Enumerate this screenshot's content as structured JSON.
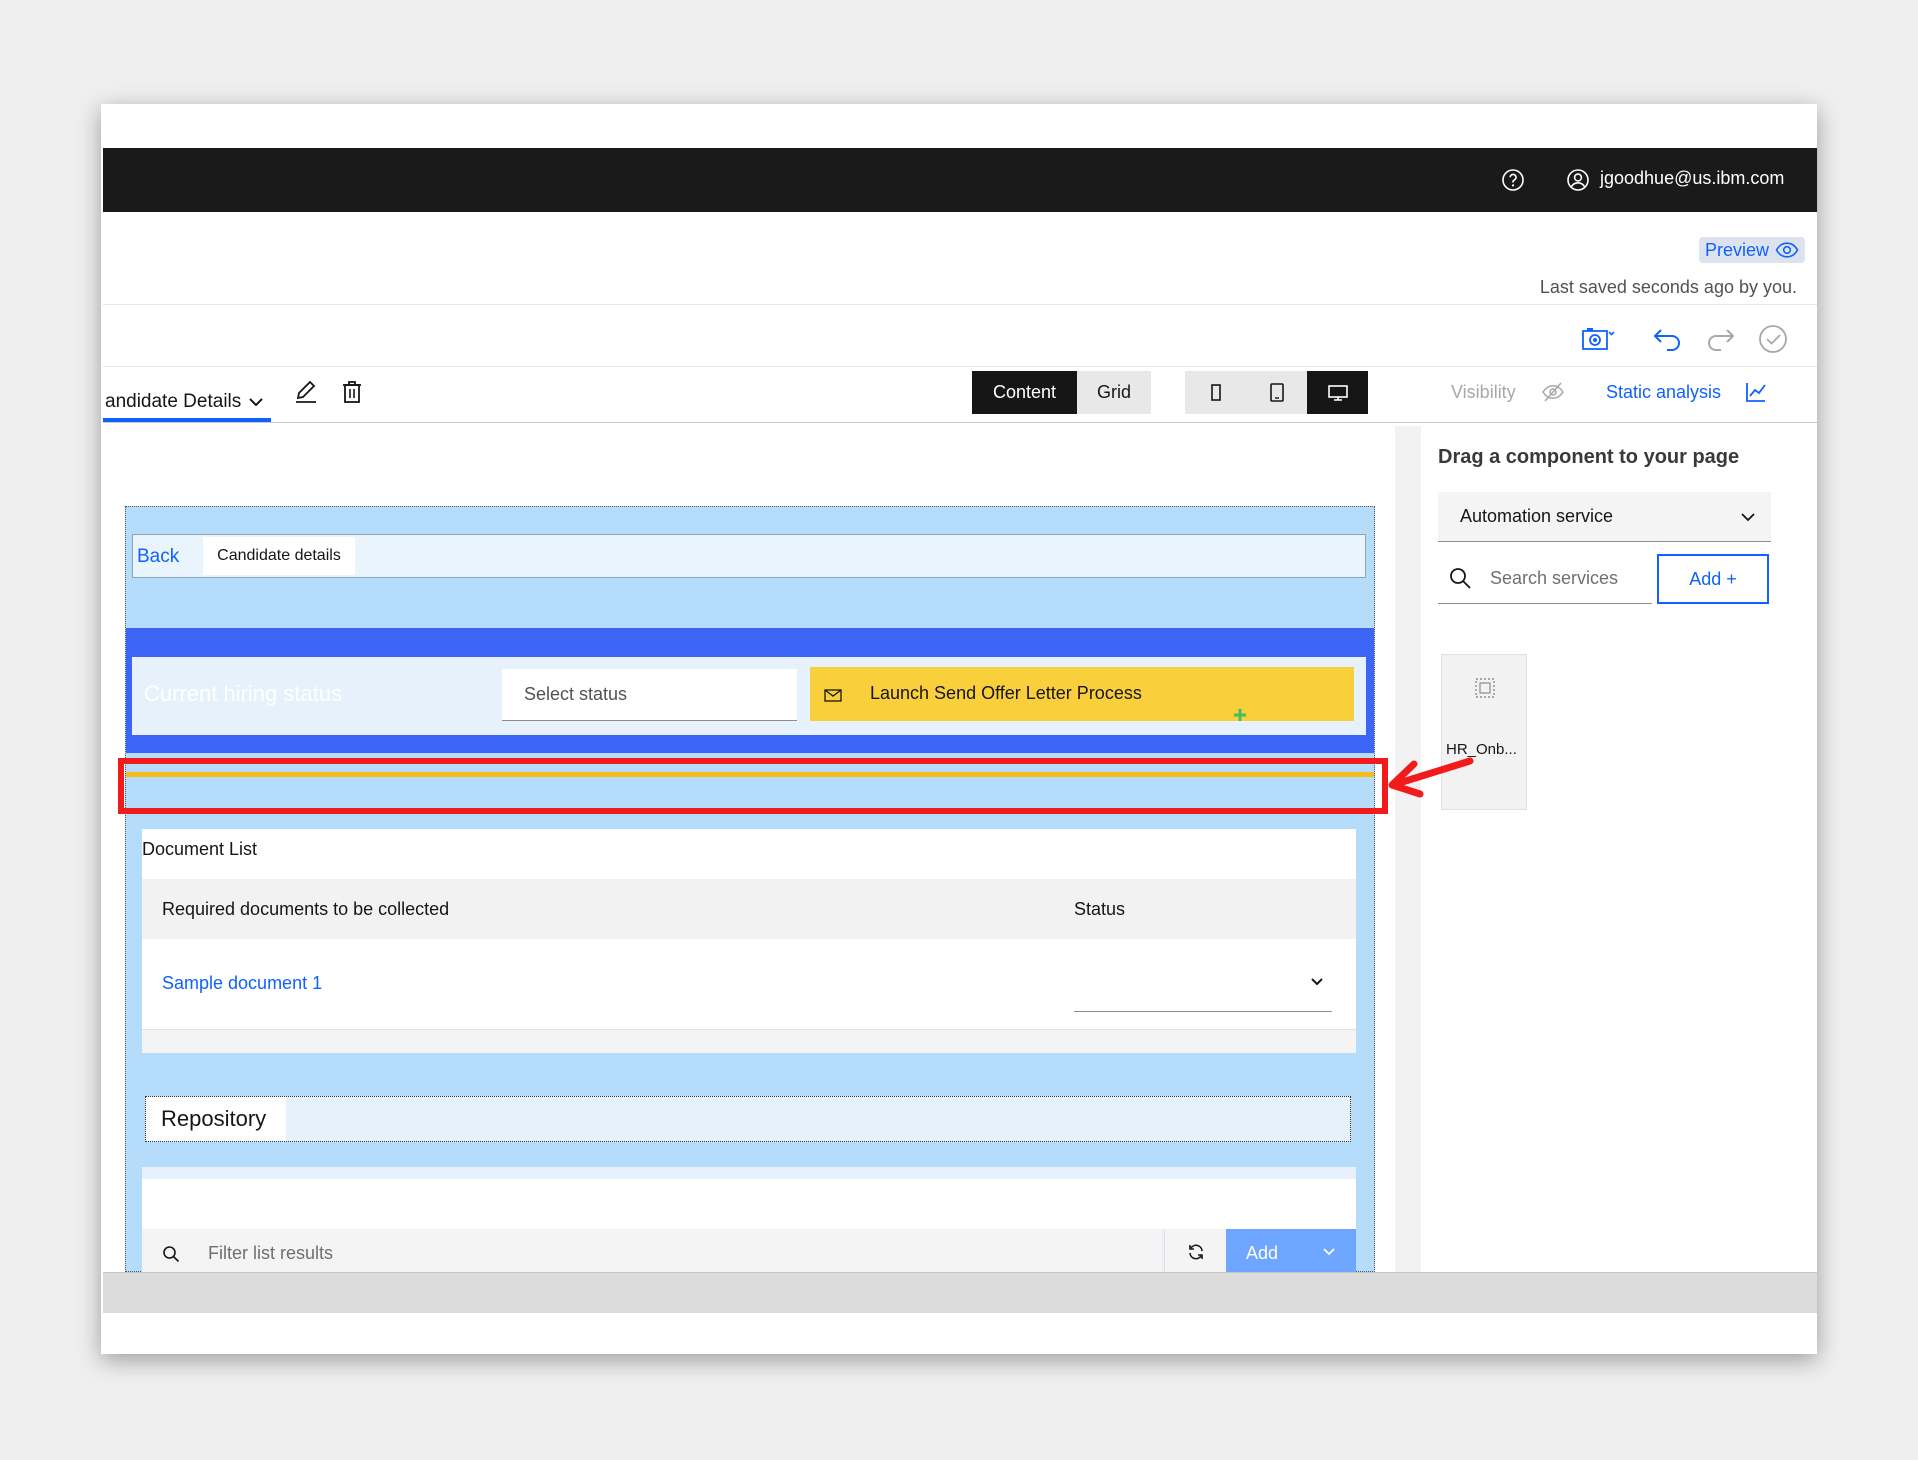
{
  "topbar": {
    "user_email": "jgoodhue@us.ibm.com",
    "help_icon": "help-icon",
    "user_icon": "user-avatar-icon"
  },
  "header": {
    "preview_label": "Preview",
    "last_saved": "Last saved seconds ago by you."
  },
  "toolbar": {
    "page_name": "andidate Details",
    "content_label": "Content",
    "grid_label": "Grid",
    "visibility_label": "Visibility",
    "static_analysis_label": "Static analysis"
  },
  "palette": {
    "title": "Drag a component to your page",
    "service_select": "Automation service",
    "search_placeholder": "Search services",
    "add_label": "Add +",
    "tile_label": "HR_Onb..."
  },
  "canvas": {
    "back_label": "Back",
    "candidate_tab": "Candidate details",
    "hiring_status_title": "Current hiring status",
    "select_status_placeholder": "Select status",
    "launch_button": "Launch Send Offer Letter Process",
    "document_list_title": "Document List",
    "doc_col_required": "Required documents to be collected",
    "doc_col_status": "Status",
    "doc_row_1": "Sample document 1",
    "repository_label": "Repository",
    "filter_placeholder": "Filter list results",
    "add_label": "Add"
  },
  "colors": {
    "accent": "#0f62fe",
    "topbar": "#1a1a1a",
    "launch_button": "#f9d03b",
    "highlight": "#f21b1b",
    "blue_band": "#3c64f5",
    "page_bg": "#b6dcfc"
  }
}
